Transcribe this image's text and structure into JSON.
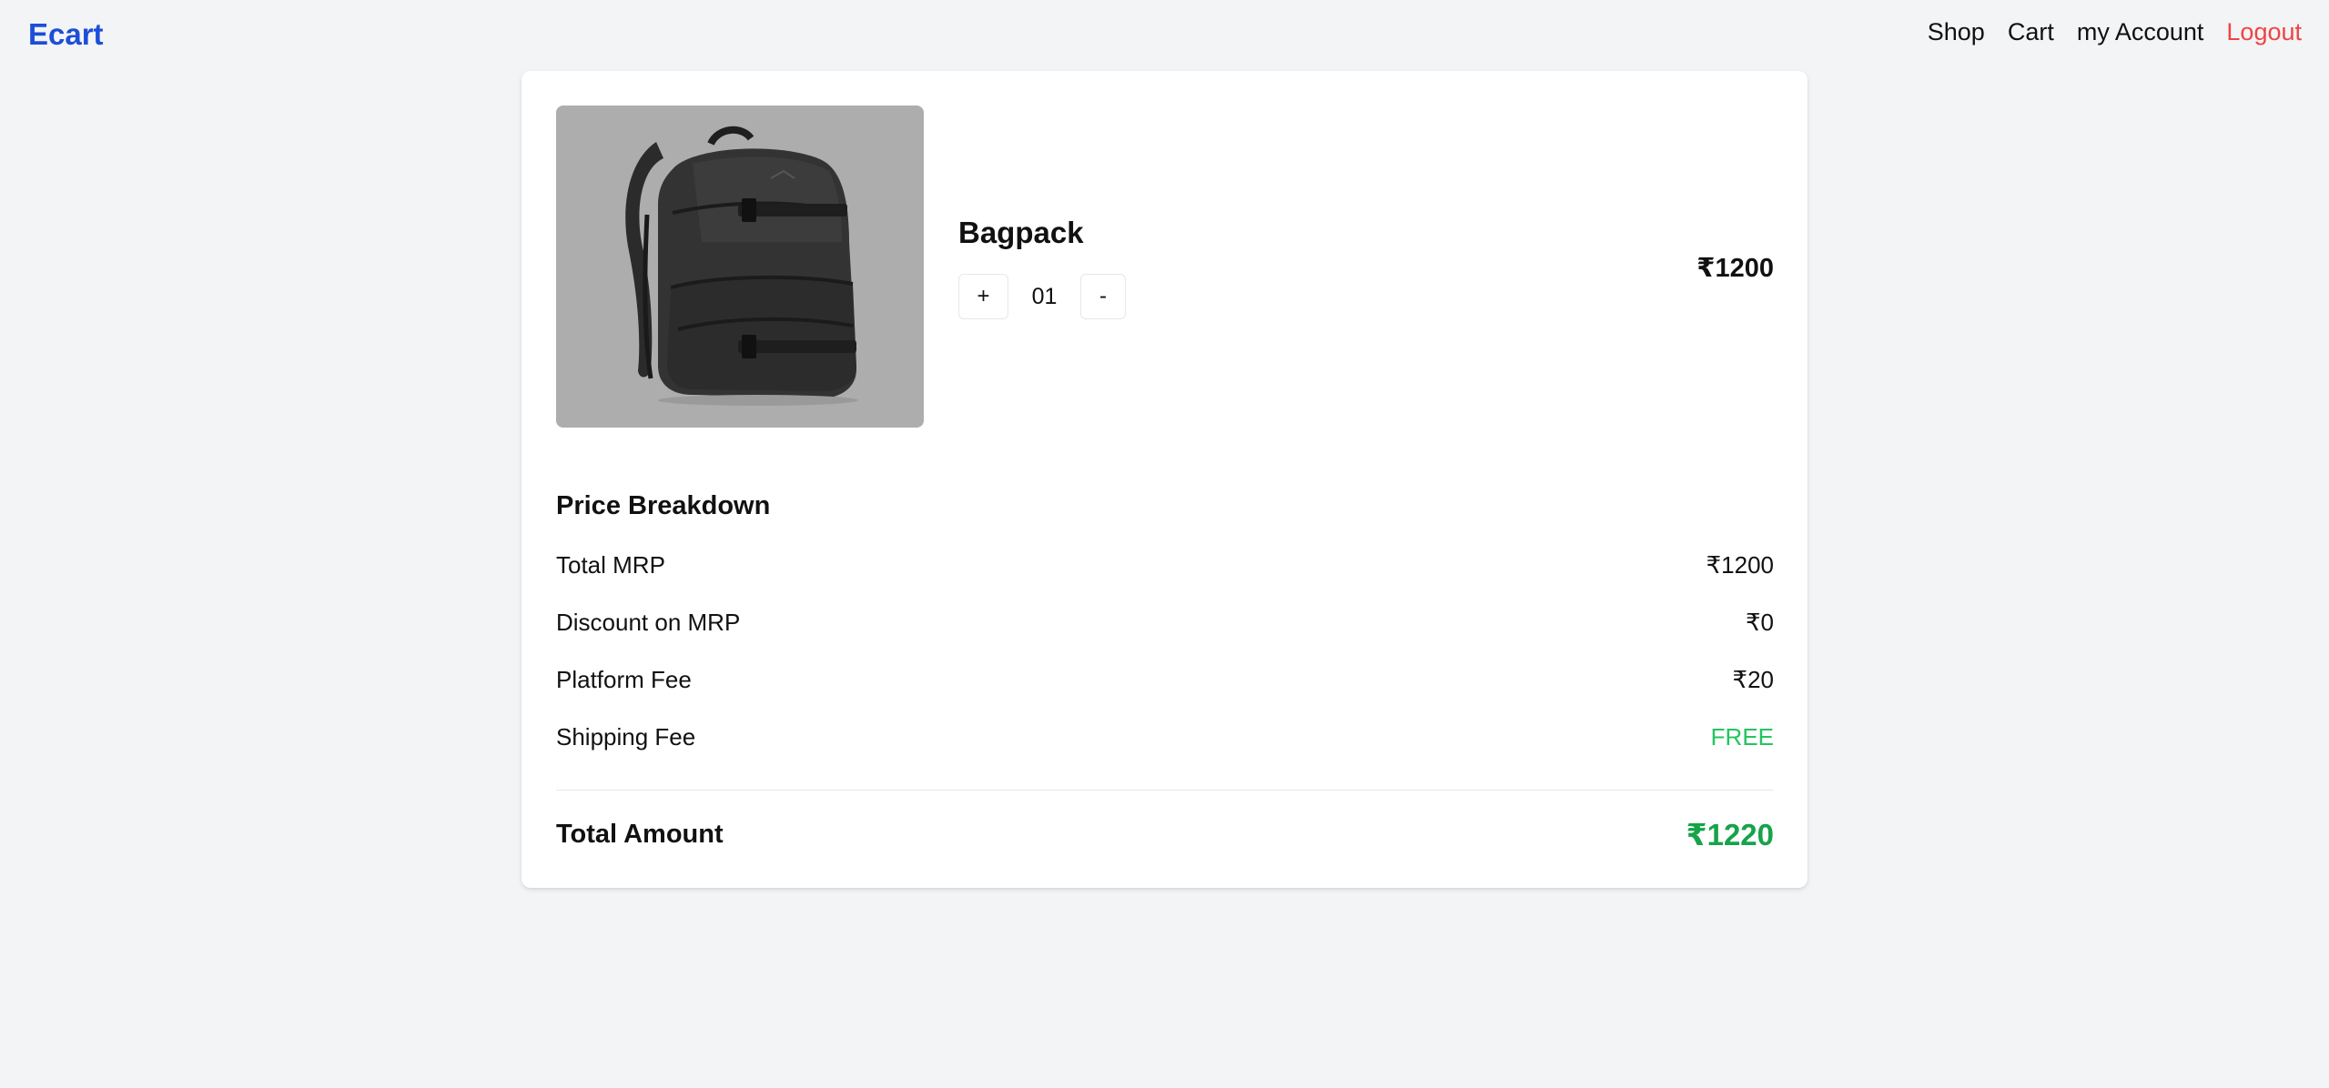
{
  "header": {
    "brand": "Ecart",
    "nav": {
      "shop": "Shop",
      "cart": "Cart",
      "account": "my Account",
      "logout": "Logout"
    }
  },
  "cart_item": {
    "name": "Bagpack",
    "image_icon": "backpack-image",
    "quantity": "01",
    "increment_label": "+",
    "decrement_label": "-",
    "price": "₹1200"
  },
  "price_breakdown": {
    "title": "Price Breakdown",
    "rows": [
      {
        "label": "Total MRP",
        "value": "₹1200"
      },
      {
        "label": "Discount on MRP",
        "value": "₹0"
      },
      {
        "label": "Platform Fee",
        "value": "₹20"
      },
      {
        "label": "Shipping Fee",
        "value": "FREE"
      }
    ],
    "total_label": "Total Amount",
    "total_value": "₹1220"
  },
  "colors": {
    "brand": "#1d4ed8",
    "logout": "#ef4444",
    "free": "#22c55e",
    "total": "#16a34a"
  }
}
